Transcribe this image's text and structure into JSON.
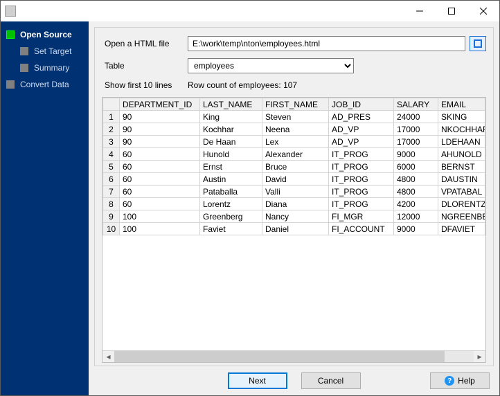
{
  "sidebar": {
    "steps": [
      {
        "label": "Open Source",
        "active": true,
        "sub": false
      },
      {
        "label": "Set Target",
        "active": false,
        "sub": true
      },
      {
        "label": "Summary",
        "active": false,
        "sub": true
      },
      {
        "label": "Convert Data",
        "active": false,
        "sub": false
      }
    ]
  },
  "form": {
    "file_label": "Open a HTML file",
    "file_value": "E:\\work\\temp\\nton\\employees.html",
    "table_label": "Table",
    "table_value": "employees",
    "show_first_label": "Show first 10 lines",
    "row_count_label": "Row count of employees: 107"
  },
  "grid": {
    "columns": [
      "DEPARTMENT_ID",
      "LAST_NAME",
      "FIRST_NAME",
      "JOB_ID",
      "SALARY",
      "EMAIL"
    ],
    "rows": [
      [
        "90",
        "King",
        "Steven",
        "AD_PRES",
        "24000",
        "SKING"
      ],
      [
        "90",
        "Kochhar",
        "Neena",
        "AD_VP",
        "17000",
        "NKOCHHAR"
      ],
      [
        "90",
        "De Haan",
        "Lex",
        "AD_VP",
        "17000",
        "LDEHAAN"
      ],
      [
        "60",
        "Hunold",
        "Alexander",
        "IT_PROG",
        "9000",
        "AHUNOLD"
      ],
      [
        "60",
        "Ernst",
        "Bruce",
        "IT_PROG",
        "6000",
        "BERNST"
      ],
      [
        "60",
        "Austin",
        "David",
        "IT_PROG",
        "4800",
        "DAUSTIN"
      ],
      [
        "60",
        "Pataballa",
        "Valli",
        "IT_PROG",
        "4800",
        "VPATABAL"
      ],
      [
        "60",
        "Lorentz",
        "Diana",
        "IT_PROG",
        "4200",
        "DLORENTZ"
      ],
      [
        "100",
        "Greenberg",
        "Nancy",
        "FI_MGR",
        "12000",
        "NGREENBE"
      ],
      [
        "100",
        "Faviet",
        "Daniel",
        "FI_ACCOUNT",
        "9000",
        "DFAVIET"
      ]
    ]
  },
  "buttons": {
    "next": "Next",
    "cancel": "Cancel",
    "help": "Help"
  }
}
